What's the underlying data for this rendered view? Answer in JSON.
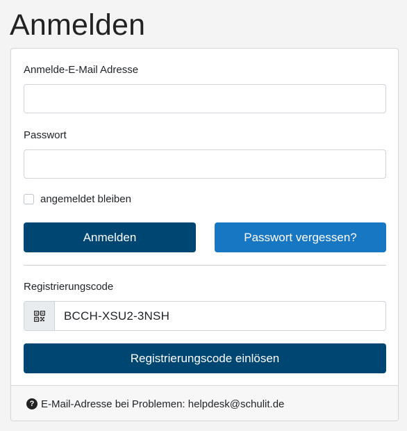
{
  "page": {
    "title": "Anmelden"
  },
  "login": {
    "email_label": "Anmelde-E-Mail Adresse",
    "email_value": "",
    "password_label": "Passwort",
    "password_value": "",
    "remember_label": "angemeldet bleiben",
    "remember_checked": false,
    "login_button": "Anmelden",
    "forgot_button": "Passwort vergessen?"
  },
  "registration": {
    "label": "Registrierungscode",
    "code_icon": "qrcode-icon",
    "code_value": "BCCH-XSU2-3NSH",
    "redeem_button": "Registrierungscode einlösen"
  },
  "footer": {
    "icon": "question-circle-icon",
    "text": "E-Mail-Adresse bei Problemen: helpdesk@schulit.de"
  },
  "colors": {
    "primary": "#004673",
    "info": "#1877c2",
    "background": "#f4f4f4"
  }
}
